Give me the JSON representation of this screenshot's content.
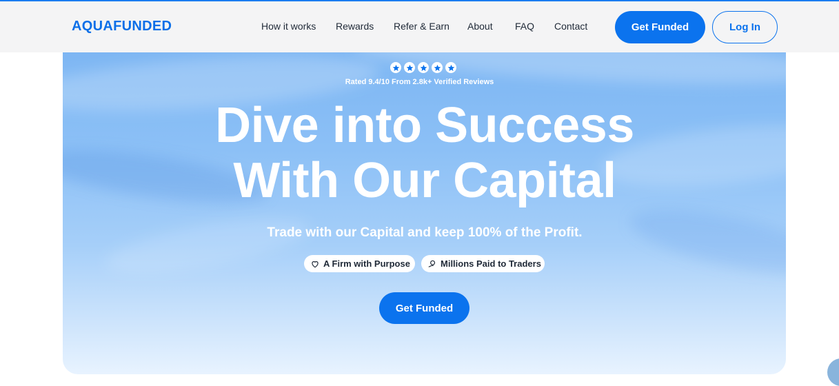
{
  "brand": {
    "logo_text": "AQUAFUNDED",
    "accent": "#0b73ee"
  },
  "nav": {
    "items": [
      {
        "label": "How it works"
      },
      {
        "label": "Rewards"
      },
      {
        "label": "Refer & Earn"
      },
      {
        "label": "About"
      },
      {
        "label": "FAQ"
      },
      {
        "label": "Contact"
      }
    ],
    "get_funded_label": "Get Funded",
    "login_label": "Log In"
  },
  "hero": {
    "stars": 5,
    "rating_text": "Rated 9.4/10 From 2.8k+ Verified Reviews",
    "headline_line1": "Dive into Success",
    "headline_line2": "With Our Capital",
    "subheadline": "Trade with our Capital and keep 100% of the Profit.",
    "badges": [
      {
        "label": "A Firm with Purpose",
        "icon": "heart-icon"
      },
      {
        "label": "Millions Paid to Traders",
        "icon": "coin-hand-icon"
      }
    ],
    "cta_label": "Get Funded"
  }
}
